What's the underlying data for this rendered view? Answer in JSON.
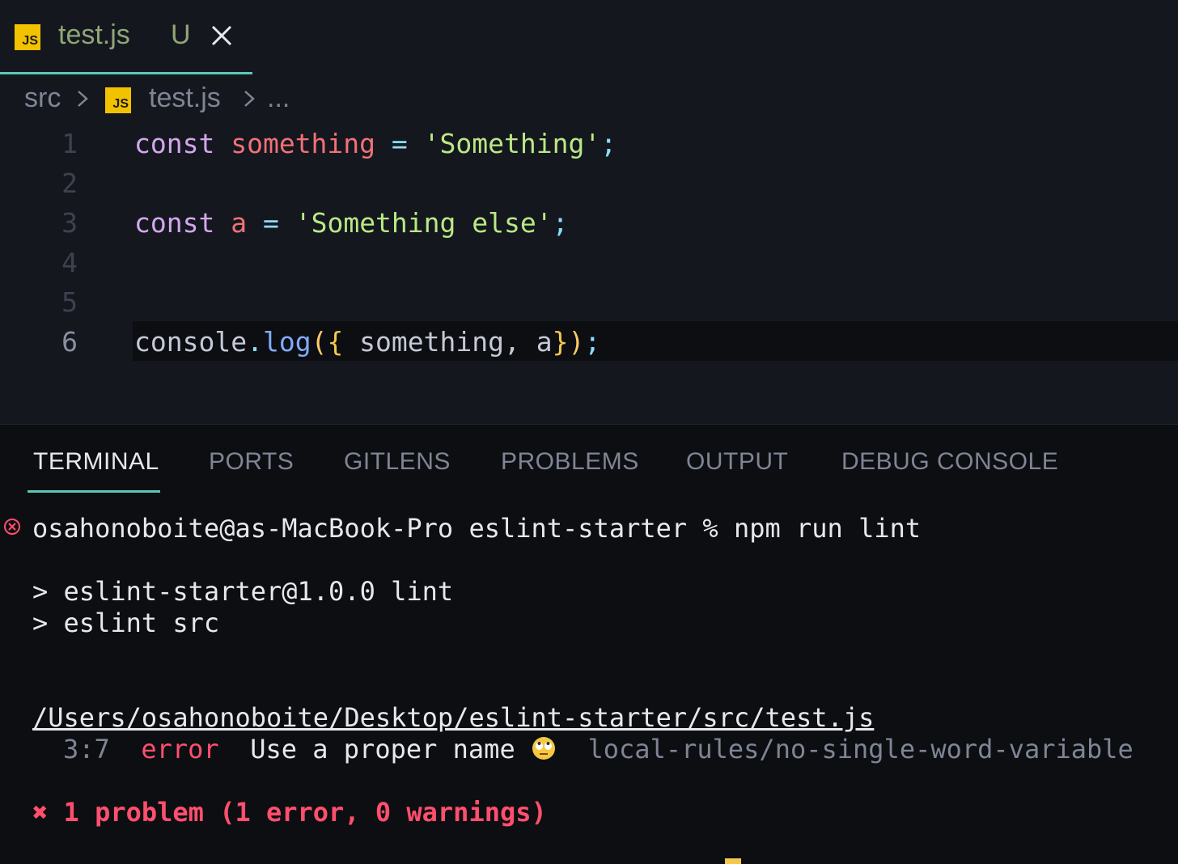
{
  "editor": {
    "tab": {
      "icon": "js-file-icon",
      "badge": "JS",
      "name": "test.js",
      "status": "U"
    },
    "breadcrumb": {
      "folder": "src",
      "badge": "JS",
      "file": "test.js",
      "more": "..."
    },
    "lines": [
      {
        "no": "1",
        "tokens": [
          {
            "t": "const",
            "c": "kw"
          },
          {
            "t": " ",
            "c": "plain"
          },
          {
            "t": "something",
            "c": "var"
          },
          {
            "t": " ",
            "c": "plain"
          },
          {
            "t": "=",
            "c": "op"
          },
          {
            "t": " ",
            "c": "plain"
          },
          {
            "t": "'Something'",
            "c": "str"
          },
          {
            "t": ";",
            "c": "punc"
          }
        ]
      },
      {
        "no": "2",
        "tokens": []
      },
      {
        "no": "3",
        "tokens": [
          {
            "t": "const",
            "c": "kw"
          },
          {
            "t": " ",
            "c": "plain"
          },
          {
            "t": "a",
            "c": "var"
          },
          {
            "t": " ",
            "c": "plain"
          },
          {
            "t": "=",
            "c": "op"
          },
          {
            "t": " ",
            "c": "plain"
          },
          {
            "t": "'Something else'",
            "c": "str"
          },
          {
            "t": ";",
            "c": "punc"
          }
        ]
      },
      {
        "no": "4",
        "tokens": []
      },
      {
        "no": "5",
        "tokens": []
      },
      {
        "no": "6",
        "current": true,
        "tokens": [
          {
            "t": "console",
            "c": "plain"
          },
          {
            "t": ".",
            "c": "punc"
          },
          {
            "t": "log",
            "c": "fn"
          },
          {
            "t": "(",
            "c": "paren"
          },
          {
            "t": "{",
            "c": "brace"
          },
          {
            "t": " something, a",
            "c": "plain"
          },
          {
            "t": "}",
            "c": "brace"
          },
          {
            "t": ")",
            "c": "paren"
          },
          {
            "t": ";",
            "c": "punc"
          }
        ]
      }
    ]
  },
  "panel": {
    "tabs": [
      "TERMINAL",
      "PORTS",
      "GITLENS",
      "PROBLEMS",
      "OUTPUT",
      "DEBUG CONSOLE"
    ],
    "active_tab": "TERMINAL"
  },
  "terminal": {
    "prompt": "osahonoboite@as-MacBook-Pro eslint-starter % npm run lint",
    "script_line1": "> eslint-starter@1.0.0 lint",
    "script_line2": "> eslint src",
    "file_path": "/Users/osahonoboite/Desktop/eslint-starter/src/test.js",
    "error_location": "3:7",
    "error_severity": "error",
    "error_message": "Use a proper name",
    "error_emoji": "eye-roll-emoji",
    "error_rule": "local-rules/no-single-word-variable",
    "summary": "✖ 1 problem (1 error, 0 warnings)"
  },
  "colors": {
    "accent": "#58c9b9",
    "error": "#ff4f6d",
    "js_badge": "#f2c200"
  }
}
